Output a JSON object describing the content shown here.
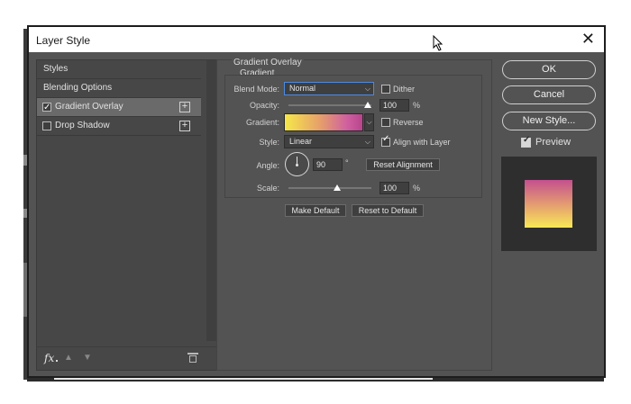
{
  "dialog": {
    "title": "Layer Style",
    "close_glyph": "✕"
  },
  "left_panel": {
    "items": [
      {
        "label": "Styles"
      },
      {
        "label": "Blending Options"
      },
      {
        "label": "Gradient Overlay",
        "checked": true,
        "selected": true
      },
      {
        "label": "Drop Shadow",
        "checked": false
      }
    ],
    "footer": {
      "fx_label": "fx"
    }
  },
  "gradient_overlay": {
    "group_title": "Gradient Overlay",
    "section_title": "Gradient",
    "blend_mode": {
      "label": "Blend Mode:",
      "value": "Normal"
    },
    "dither": {
      "label": "Dither",
      "checked": false
    },
    "opacity": {
      "label": "Opacity:",
      "value": "100",
      "unit": "%",
      "fraction": 1.0
    },
    "gradient": {
      "label": "Gradient:",
      "colors": [
        "#f6e84a",
        "#e6a06a",
        "#d060a0",
        "#b8458c"
      ]
    },
    "reverse": {
      "label": "Reverse",
      "checked": false
    },
    "style": {
      "label": "Style:",
      "value": "Linear"
    },
    "align_with_layer": {
      "label": "Align with Layer",
      "checked": true
    },
    "angle": {
      "label": "Angle:",
      "value": "90",
      "unit": "°"
    },
    "reset_alignment": "Reset Alignment",
    "scale": {
      "label": "Scale:",
      "value": "100",
      "unit": "%",
      "fraction": 0.5
    },
    "make_default": "Make Default",
    "reset_to_default": "Reset to Default"
  },
  "right_panel": {
    "ok": "OK",
    "cancel": "Cancel",
    "new_style": "New Style...",
    "preview": {
      "label": "Preview",
      "checked": true
    }
  },
  "colors": {
    "dialog_bg": "#535353",
    "panel_bg": "#474747",
    "focus_blue": "#4d8ae0"
  }
}
